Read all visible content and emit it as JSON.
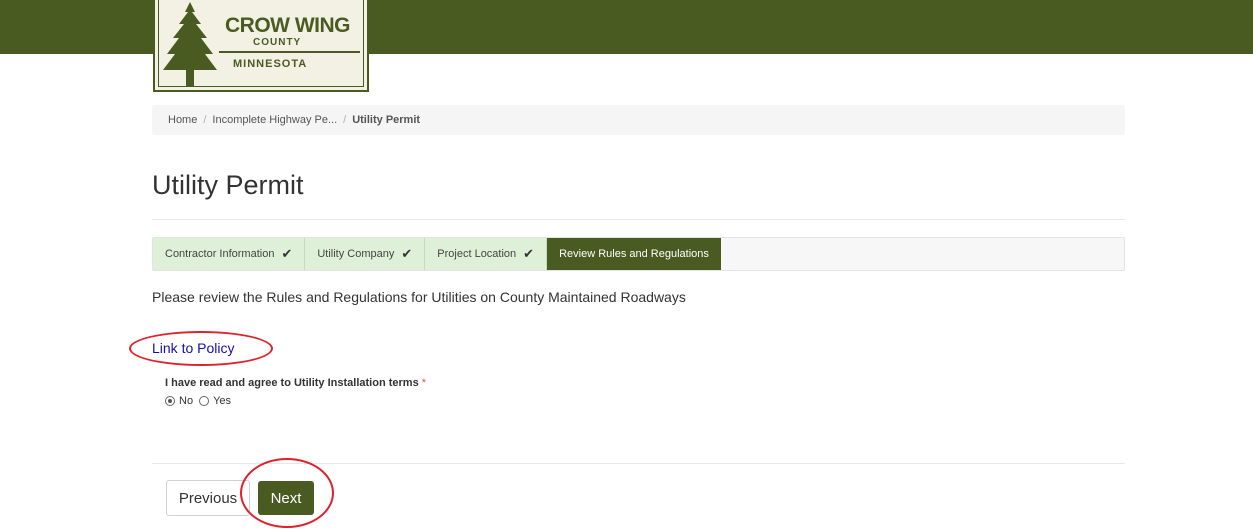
{
  "header": {
    "logo": {
      "line1": "CROW WING",
      "line2": "COUNTY",
      "line3": "MINNESOTA"
    },
    "bar_color": "#4a5b22"
  },
  "breadcrumb": {
    "home": "Home",
    "middle": "Incomplete Highway Pe...",
    "current": "Utility Permit"
  },
  "page": {
    "title": "Utility Permit"
  },
  "steps": [
    {
      "label": "Contractor Information",
      "done": true
    },
    {
      "label": "Utility Company",
      "done": true
    },
    {
      "label": "Project Location",
      "done": true
    },
    {
      "label": "Review Rules and Regulations",
      "active": true
    }
  ],
  "icons": {
    "check": "✔",
    "check_name": "checkmark-icon"
  },
  "content": {
    "intro": "Please review the Rules and Regulations for Utilities on County Maintained Roadways",
    "policy_link": "Link to Policy"
  },
  "form": {
    "terms_label": "I have read and agree to Utility Installation terms",
    "required_mark": "*",
    "options": [
      "No",
      "Yes"
    ],
    "selected": "No"
  },
  "buttons": {
    "previous": "Previous",
    "next": "Next"
  },
  "colors": {
    "accent": "#4a5b22",
    "step_done": "#dff0d8",
    "annotation": "#e0202a",
    "link": "#1a0dab"
  }
}
